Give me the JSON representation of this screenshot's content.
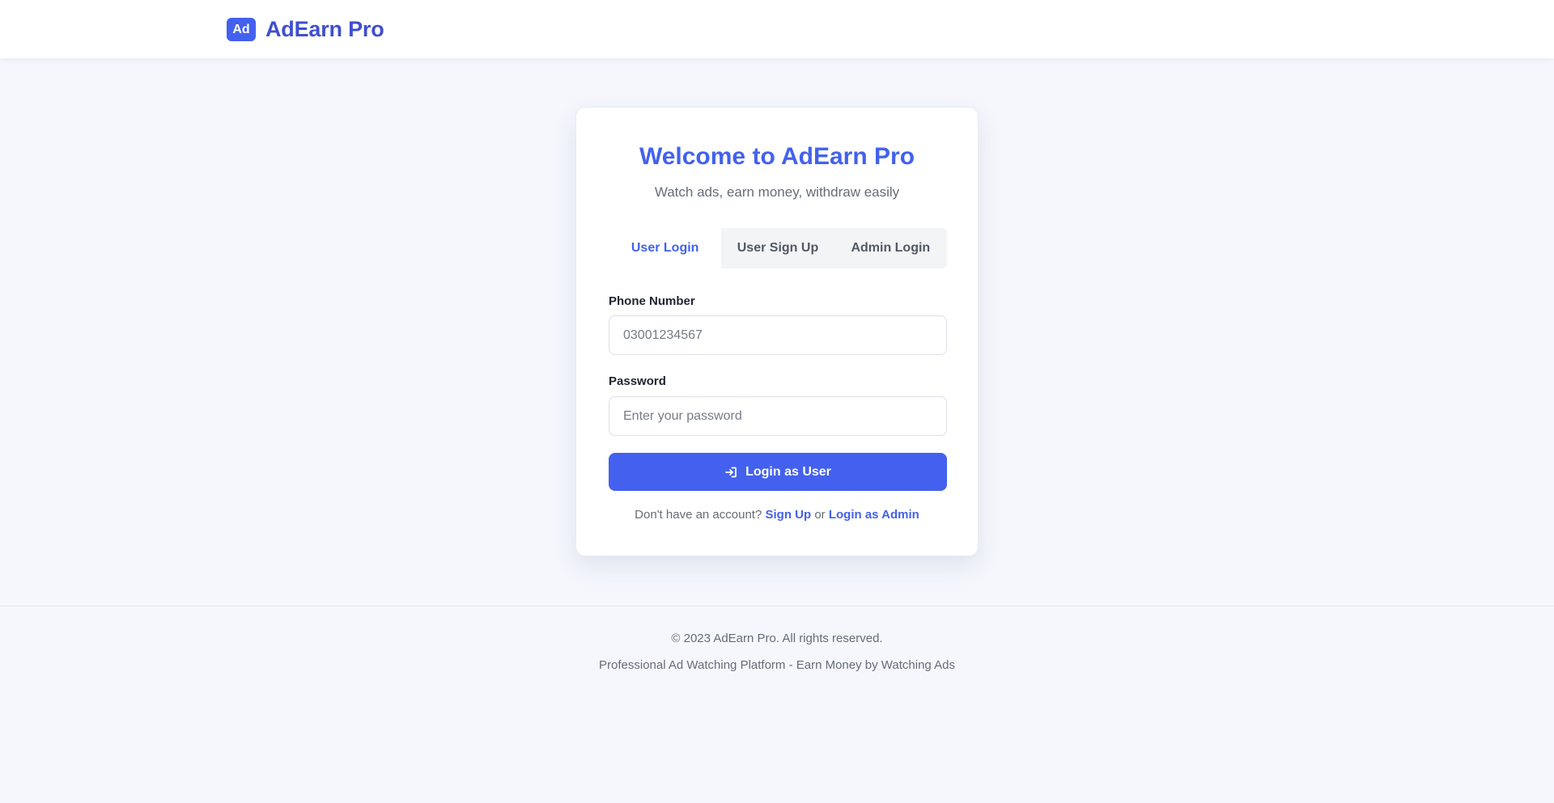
{
  "header": {
    "logo_text": "Ad",
    "brand_name": "AdEarn Pro"
  },
  "card": {
    "title": "Welcome to AdEarn Pro",
    "subtitle": "Watch ads, earn money, withdraw easily",
    "tabs": [
      {
        "label": "User Login",
        "active": true
      },
      {
        "label": "User Sign Up",
        "active": false
      },
      {
        "label": "Admin Login",
        "active": false
      }
    ],
    "phone": {
      "label": "Phone Number",
      "placeholder": "03001234567"
    },
    "password": {
      "label": "Password",
      "placeholder": "Enter your password"
    },
    "login_button": {
      "label": "Login as User",
      "icon": "sign-in-icon"
    },
    "footer": {
      "prompt": "Don't have an account?",
      "signup_link": "Sign Up",
      "or_text": "or",
      "admin_link": "Login as Admin"
    }
  },
  "page_footer": {
    "copyright": "© 2023 AdEarn Pro. All rights reserved.",
    "tagline": "Professional Ad Watching Platform - Earn Money by Watching Ads"
  },
  "colors": {
    "accent": "#4361ee",
    "brand_text": "#3f4fcf",
    "background": "#f5f7fd"
  }
}
